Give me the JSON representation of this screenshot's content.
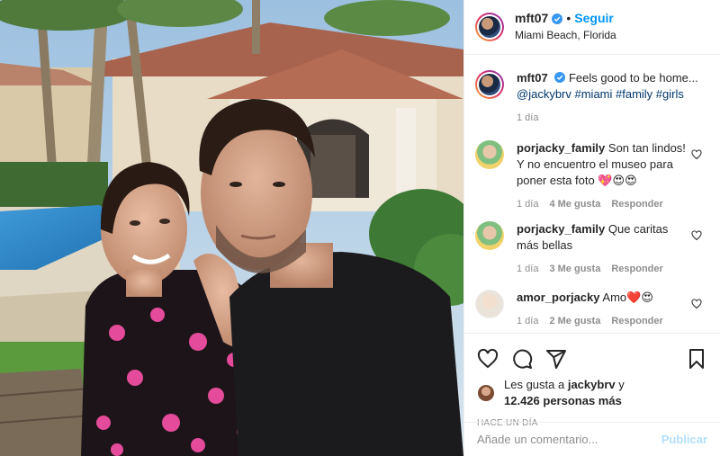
{
  "post": {
    "username": "mft07",
    "follow_label": "Seguir",
    "location": "Miami Beach, Florida",
    "verified_icon": "verified-badge-icon",
    "accent": "#0095f6"
  },
  "caption": {
    "username": "mft07",
    "text": "Feels good to be home...",
    "mention": "@jackybrv",
    "hashtags": "#miami #family #girls",
    "time": "1 día"
  },
  "comments": [
    {
      "username": "porjacky_family",
      "text": "Son tan lindos! Y no encuentro el museo para poner esta foto 💖😍😍",
      "time": "1 día",
      "likes": "4 Me gusta",
      "reply": "Responder"
    },
    {
      "username": "porjacky_family",
      "text": "Que caritas más bellas",
      "time": "1 día",
      "likes": "3 Me gusta",
      "reply": "Responder"
    },
    {
      "username": "amor_porjacky",
      "text": "Amo❤️😍",
      "time": "1 día",
      "likes": "2 Me gusta",
      "reply": "Responder"
    }
  ],
  "likes_line": {
    "prefix": "Les gusta a",
    "user": "jackybrv",
    "joiner": "y",
    "count": "12.426 personas más"
  },
  "posted_ago": "HACE UN DÍA",
  "composer": {
    "placeholder": "Añade un comentario...",
    "publish_label": "Publicar"
  }
}
